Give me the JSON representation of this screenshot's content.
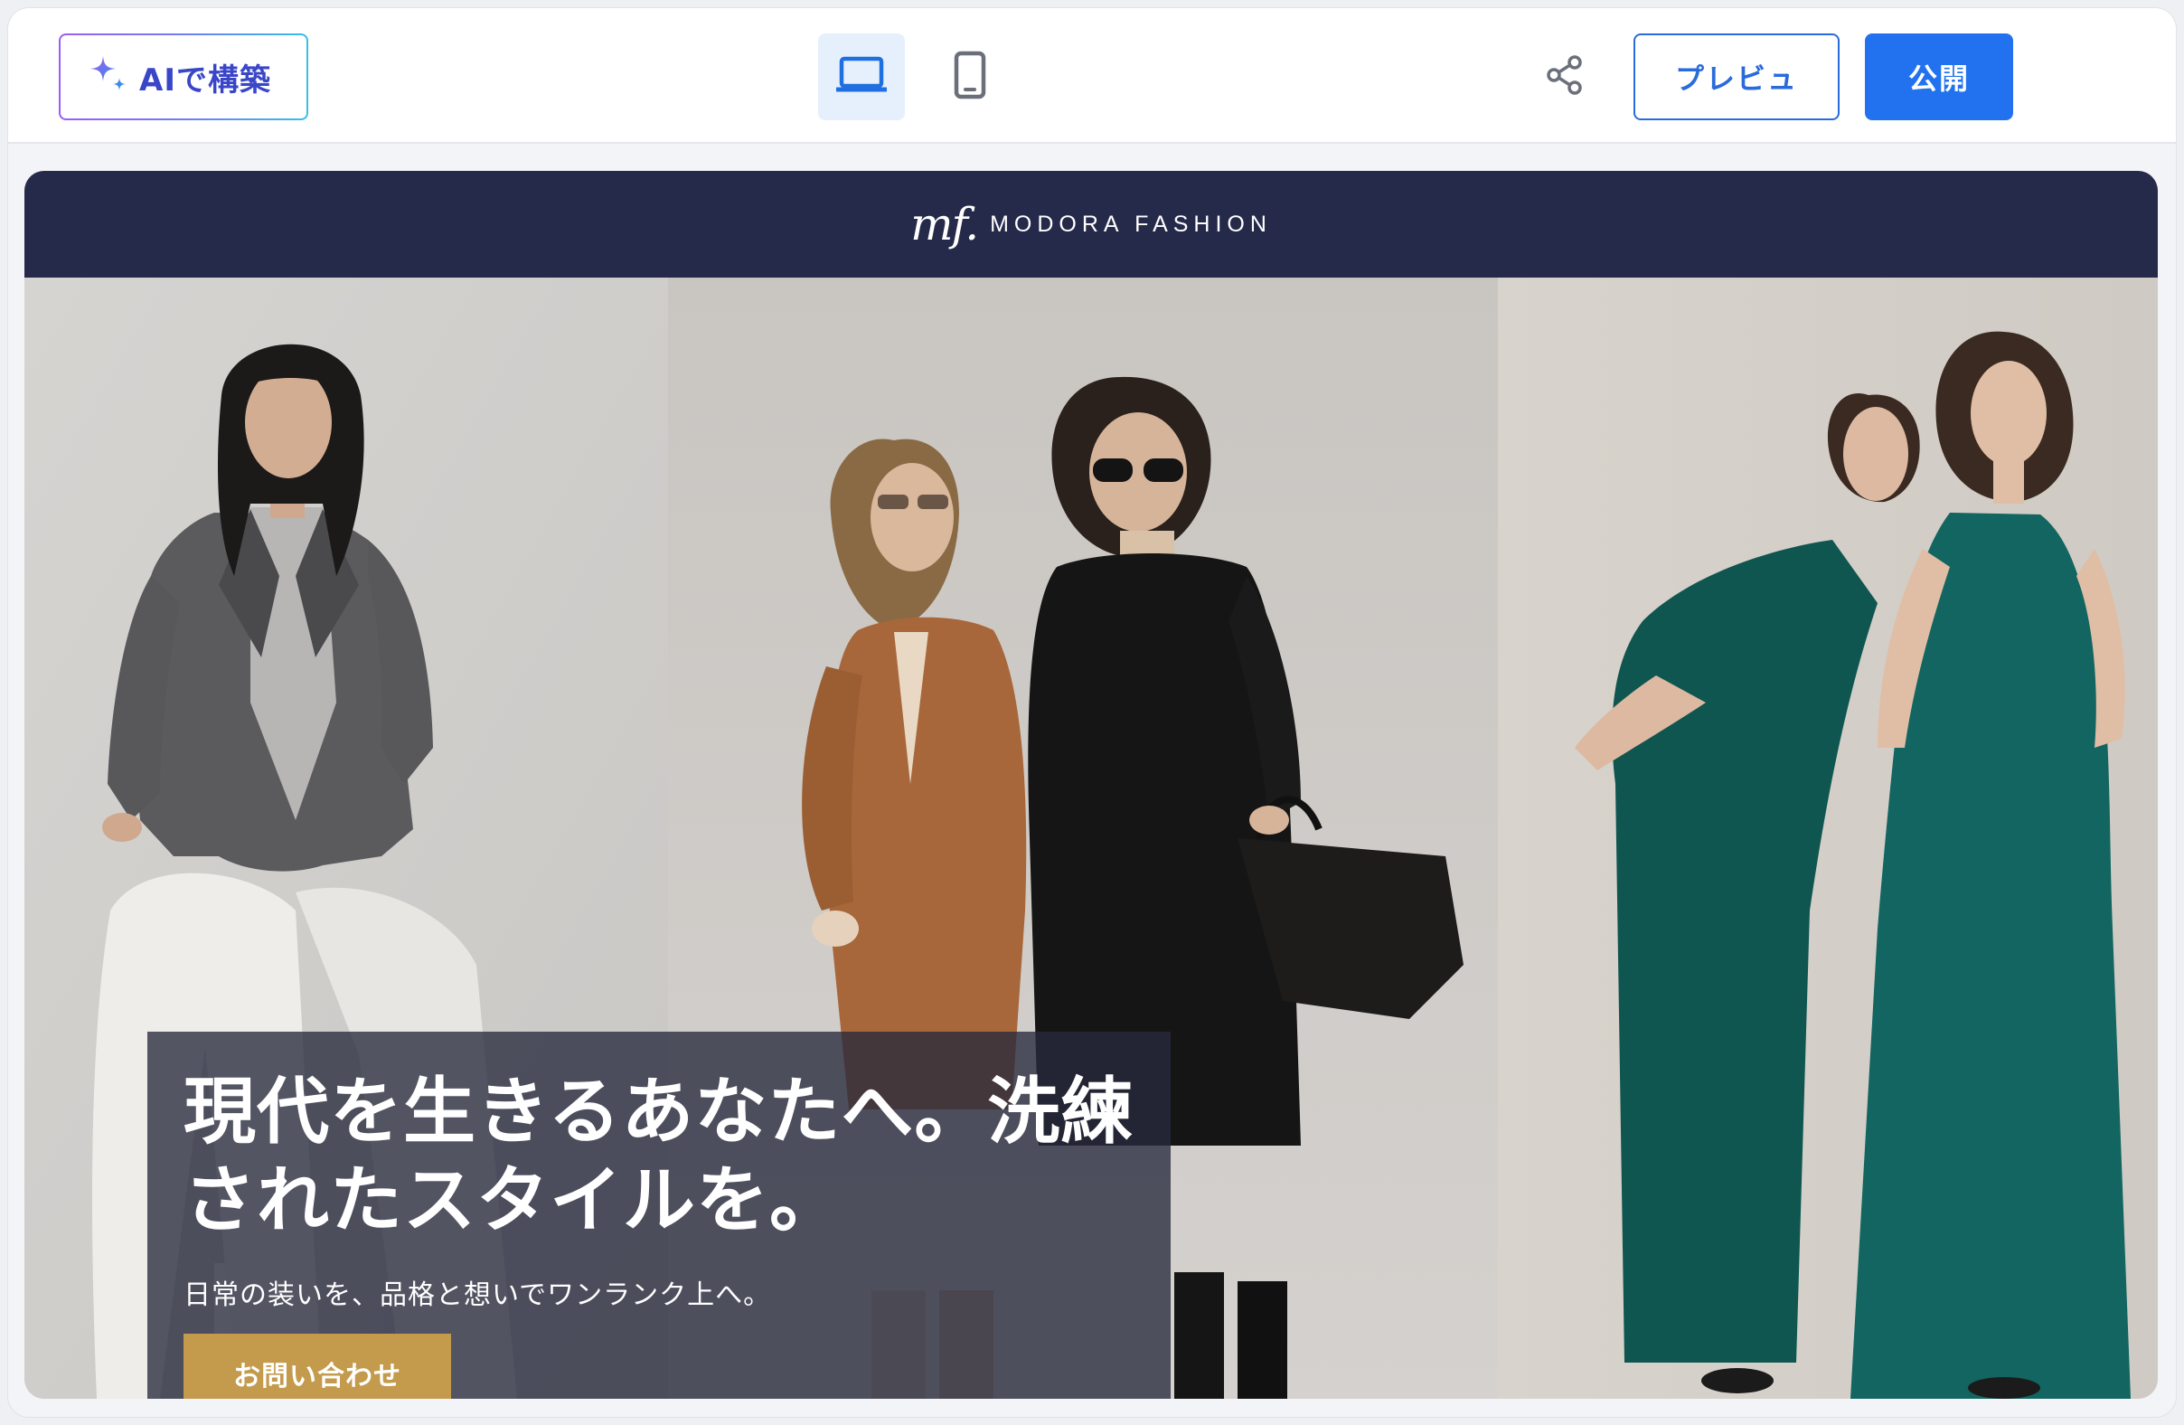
{
  "toolbar": {
    "ai_button_label": "AIで構築",
    "ai_icon": "sparkle-icon",
    "devices": [
      {
        "name": "desktop",
        "icon": "laptop-icon",
        "active": true
      },
      {
        "name": "mobile",
        "icon": "smartphone-icon",
        "active": false
      }
    ],
    "share_icon": "share-icon",
    "preview_label": "プレビュ",
    "publish_label": "公開"
  },
  "site": {
    "logo_mark": "mf.",
    "brand_name": "MODORA FASHION",
    "hero": {
      "headline_line1": "現代を生きるあなたへ。洗練",
      "headline_line2": "されたスタイルを。",
      "subheadline": "日常の装いを、品格と想いでワンランク上へ。",
      "cta_label": "お問い合わせ"
    }
  },
  "colors": {
    "accent_blue": "#2272ef",
    "site_header": "#262a4a",
    "cta_gold": "#c49a4c",
    "overlay": "#282a3e"
  }
}
